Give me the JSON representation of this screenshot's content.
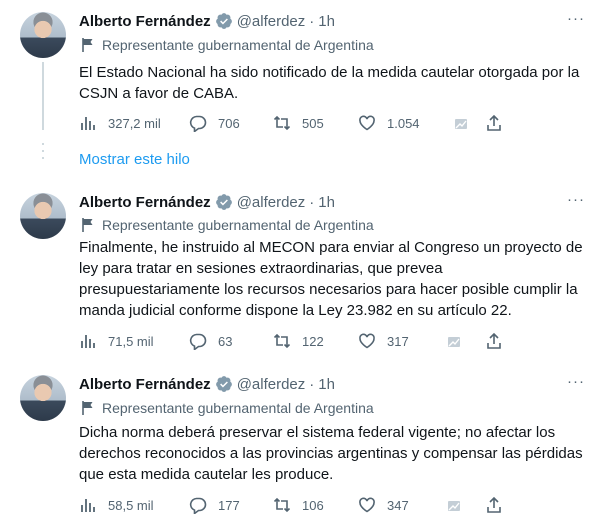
{
  "tweets": [
    {
      "name": "Alberto Fernández",
      "handle": "@alferdez",
      "time": "1h",
      "label": "Representante gubernamental de Argentina",
      "lines": [
        "El Estado Nacional ha sido notificado de la medida cautelar otorgada por la",
        "CSJN a favor de CABA."
      ],
      "views": "327,2 mil",
      "replies": "706",
      "retweets": "505",
      "likes": "1.054"
    },
    {
      "name": "Alberto Fernández",
      "handle": "@alferdez",
      "time": "1h",
      "label": "Representante gubernamental de Argentina",
      "lines": [
        "Finalmente, he instruido al MECON para enviar al Congreso un proyecto de",
        "ley para tratar en sesiones extraordinarias, que prevea",
        "presupuestariamente los recursos necesarios para hacer posible cumplir la",
        "manda judicial conforme dispone la Ley 23.982 en su artículo 22."
      ],
      "views": "71,5 mil",
      "replies": "63",
      "retweets": "122",
      "likes": "317"
    },
    {
      "name": "Alberto Fernández",
      "handle": "@alferdez",
      "time": "1h",
      "label": "Representante gubernamental de Argentina",
      "lines": [
        "Dicha norma deberá preservar el sistema federal vigente; no afectar los",
        "derechos reconocidos a las provincias argentinas y compensar las pérdidas",
        "que esta medida cautelar les produce."
      ],
      "views": "58,5 mil",
      "replies": "177",
      "retweets": "106",
      "likes": "347"
    }
  ],
  "show_thread": "Mostrar este hilo",
  "separator": "·",
  "icons": {
    "verified": "verified-badge-icon",
    "more": "more-options-icon",
    "label": "flag-icon",
    "views": "analytics-bars-icon",
    "reply": "reply-bubble-icon",
    "retweet": "retweet-icon",
    "like": "heart-icon",
    "tip": "tip-jar-icon",
    "share": "share-upload-icon"
  },
  "colors": {
    "accent": "#1d9bf0",
    "muted": "#536471",
    "text": "#0f1419",
    "line": "#cfd9de"
  }
}
